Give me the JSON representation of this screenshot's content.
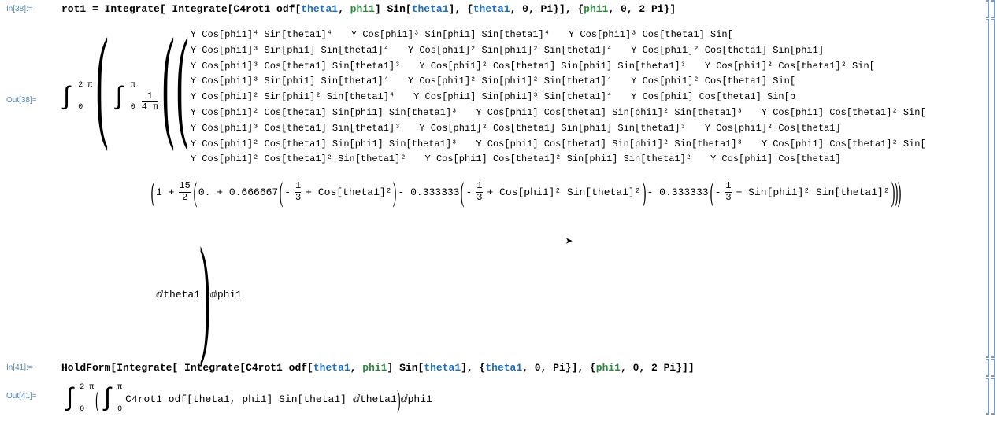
{
  "in38": {
    "label": "In[38]:=",
    "code_prefix": "rot1 = Integrate[ Integrate[C4rot1 odf[",
    "arg1": "theta1",
    "arg2": "phi1",
    "code_mid1": "] Sin[",
    "arg3": "theta1",
    "code_mid2": "], {",
    "arg4": "theta1",
    "code_mid3": ", 0, Pi}], {",
    "arg5": "phi1",
    "code_suffix": ", 0, 2 Pi}]"
  },
  "out38": {
    "label": "Out[38]=",
    "int1_top": "2 π",
    "int1_bot": "0",
    "int2_top": "π",
    "int2_bot": "0",
    "frac_top": "1",
    "frac_bot": "4 π",
    "matrix": [
      [
        "Y Cos[phi1]⁴ Sin[theta1]⁴",
        "Y Cos[phi1]³ Sin[phi1] Sin[theta1]⁴",
        "Y Cos[phi1]³ Cos[theta1] Sin["
      ],
      [
        "Y Cos[phi1]³ Sin[phi1] Sin[theta1]⁴",
        "Y Cos[phi1]² Sin[phi1]² Sin[theta1]⁴",
        "Y Cos[phi1]² Cos[theta1] Sin[phi1]"
      ],
      [
        "Y Cos[phi1]³ Cos[theta1] Sin[theta1]³",
        "Y Cos[phi1]² Cos[theta1] Sin[phi1] Sin[theta1]³",
        "Y Cos[phi1]² Cos[theta1]² Sin["
      ],
      [
        "Y Cos[phi1]³ Sin[phi1] Sin[theta1]⁴",
        "Y Cos[phi1]² Sin[phi1]² Sin[theta1]⁴",
        "Y Cos[phi1]² Cos[theta1] Sin["
      ],
      [
        "Y Cos[phi1]² Sin[phi1]² Sin[theta1]⁴",
        "Y Cos[phi1] Sin[phi1]³ Sin[theta1]⁴",
        "Y Cos[phi1] Cos[theta1] Sin[p"
      ],
      [
        "Y Cos[phi1]² Cos[theta1] Sin[phi1] Sin[theta1]³",
        "Y Cos[phi1] Cos[theta1] Sin[phi1]² Sin[theta1]³",
        "Y Cos[phi1] Cos[theta1]² Sin["
      ],
      [
        "Y Cos[phi1]³ Cos[theta1] Sin[theta1]³",
        "Y Cos[phi1]² Cos[theta1] Sin[phi1] Sin[theta1]³",
        "Y Cos[phi1]² Cos[theta1]"
      ],
      [
        "Y Cos[phi1]² Cos[theta1] Sin[phi1] Sin[theta1]³",
        "Y Cos[phi1] Cos[theta1] Sin[phi1]² Sin[theta1]³",
        "Y Cos[phi1] Cos[theta1]² Sin["
      ],
      [
        "Y Cos[phi1]² Cos[theta1]² Sin[theta1]²",
        "Y Cos[phi1] Cos[theta1]² Sin[phi1] Sin[theta1]²",
        "Y Cos[phi1] Cos[theta1]"
      ]
    ],
    "middle_expr": {
      "a": "1 +",
      "frac1_top": "15",
      "frac1_bot": "2",
      "b": "0. + 0.666667",
      "frac2_top": "1",
      "frac2_bot": "3",
      "c": "+ Cos[theta1]²",
      "d": "- 0.333333",
      "frac3_top": "1",
      "frac3_bot": "3",
      "e": "+ Cos[phi1]² Sin[theta1]²",
      "f": "- 0.333333",
      "frac4_top": "1",
      "frac4_bot": "3",
      "g": "+ Sin[phi1]² Sin[theta1]²"
    },
    "dtheta": "ⅆtheta1",
    "dphi": "ⅆphi1"
  },
  "in41": {
    "label": "In[41]:=",
    "code_prefix": "HoldForm[Integrate[ Integrate[C4rot1 odf[",
    "arg1": "theta1",
    "arg2": "phi1",
    "code_mid1": "] Sin[",
    "arg3": "theta1",
    "code_mid2": "], {",
    "arg4": "theta1",
    "code_mid3": ", 0, Pi}], {",
    "arg5": "phi1",
    "code_suffix": ", 0, 2 Pi}]]"
  },
  "out41": {
    "label": "Out[41]=",
    "int1_top": "2 π",
    "int1_bot": "0",
    "int2_top": "π",
    "int2_bot": "0",
    "body": "C4rot1 odf[theta1, phi1] Sin[theta1] ⅆtheta1",
    "tail": "ⅆphi1"
  }
}
